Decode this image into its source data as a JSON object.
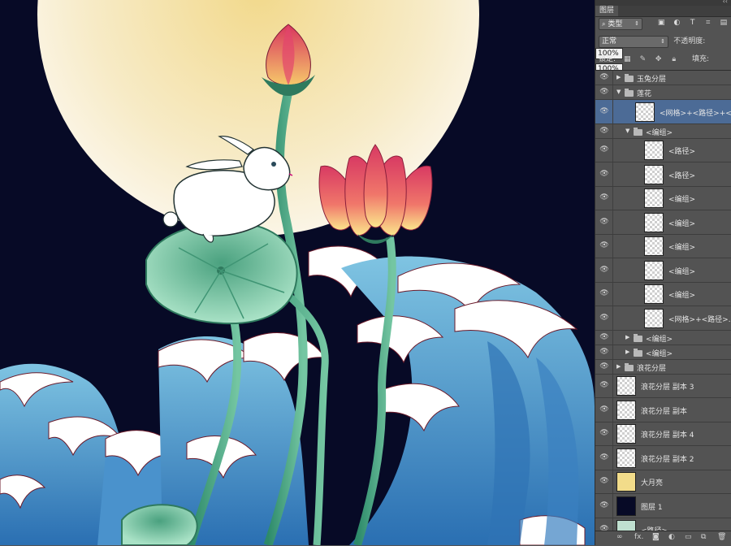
{
  "panel": {
    "tab_title": "图层",
    "filter_label": "类型",
    "blend_mode": "正常",
    "opacity_label": "不透明度:",
    "opacity_value": "100%",
    "lock_label": "锁定:",
    "fill_label": "填充:",
    "fill_value": "100%"
  },
  "layers": [
    {
      "name": "玉兔分层",
      "type": "group",
      "expanded": false,
      "indent": 0
    },
    {
      "name": "莲花",
      "type": "group",
      "expanded": true,
      "indent": 0
    },
    {
      "name": "<网格>+<路径>+<...",
      "type": "layer",
      "indent": 1,
      "selected": true
    },
    {
      "name": "<编组>",
      "type": "group",
      "expanded": true,
      "indent": 1
    },
    {
      "name": "<路径>",
      "type": "layer",
      "indent": 2
    },
    {
      "name": "<路径>",
      "type": "layer",
      "indent": 2
    },
    {
      "name": "<编组>",
      "type": "layer",
      "indent": 2
    },
    {
      "name": "<编组>",
      "type": "layer",
      "indent": 2
    },
    {
      "name": "<编组>",
      "type": "layer",
      "indent": 2
    },
    {
      "name": "<编组>",
      "type": "layer",
      "indent": 2
    },
    {
      "name": "<编组>",
      "type": "layer",
      "indent": 2
    },
    {
      "name": "<网格>+<路径>...",
      "type": "layer",
      "indent": 2
    },
    {
      "name": "<编组>",
      "type": "group",
      "expanded": false,
      "indent": 1
    },
    {
      "name": "<编组>",
      "type": "group",
      "expanded": false,
      "indent": 1
    },
    {
      "name": "浪花分层",
      "type": "group",
      "expanded": false,
      "indent": 0
    },
    {
      "name": "浪花分层 副本 3",
      "type": "layer",
      "indent": 0
    },
    {
      "name": "浪花分层 副本",
      "type": "layer",
      "indent": 0
    },
    {
      "name": "浪花分层 副本 4",
      "type": "layer",
      "indent": 0
    },
    {
      "name": "浪花分层 副本 2",
      "type": "layer",
      "indent": 0
    },
    {
      "name": "大月亮",
      "type": "layer",
      "indent": 0,
      "thumb_color": "#f2dc8a"
    },
    {
      "name": "图层 1",
      "type": "layer",
      "indent": 0,
      "thumb_color": "#070a26"
    },
    {
      "name": "<路径>",
      "type": "layer",
      "indent": 0,
      "thumb_color": "#bfe0d0"
    }
  ],
  "colors": {
    "canvas_bg": "#070a26",
    "moon": "#f5e2a6",
    "lotus": "#e0456e",
    "leaf": "#6fc2a0",
    "wave": "#3f86c4",
    "selection": "#4c6b96"
  }
}
